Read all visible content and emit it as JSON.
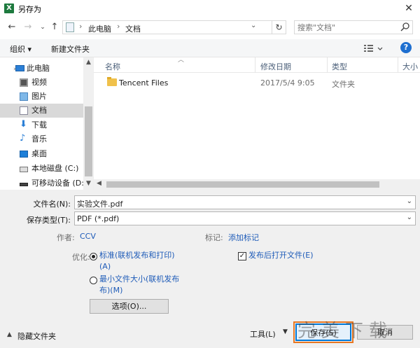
{
  "window": {
    "title": "另存为",
    "app_icon_letter": "X"
  },
  "address": {
    "path": [
      "此电脑",
      "文档"
    ],
    "search_placeholder": "搜索\"文档\""
  },
  "toolbar": {
    "organize": "组织 ▾",
    "new_folder": "新建文件夹",
    "help": "?"
  },
  "nav": {
    "items": [
      {
        "label": "此电脑",
        "icon": "computer-icon"
      },
      {
        "label": "视频",
        "icon": "video-icon"
      },
      {
        "label": "图片",
        "icon": "picture-icon"
      },
      {
        "label": "文档",
        "icon": "document-icon",
        "selected": true
      },
      {
        "label": "下载",
        "icon": "download-icon"
      },
      {
        "label": "音乐",
        "icon": "music-icon"
      },
      {
        "label": "桌面",
        "icon": "desktop-icon"
      },
      {
        "label": "本地磁盘 (C:)",
        "icon": "drive-icon"
      },
      {
        "label": "可移动设备 (D:)",
        "icon": "removable-drive-icon"
      }
    ]
  },
  "filelist": {
    "columns": [
      "名称",
      "修改日期",
      "类型",
      "大小"
    ],
    "rows": [
      {
        "name": "Tencent Files",
        "date": "2017/5/4 9:05",
        "type": "文件夹"
      }
    ]
  },
  "form": {
    "filename_label": "文件名(N):",
    "filename_value": "实验文件.pdf",
    "filetype_label": "保存类型(T):",
    "filetype_value": "PDF (*.pdf)",
    "author_label": "作者:",
    "author_value": "CCV",
    "tags_label": "标记:",
    "tags_value": "添加标记",
    "optimize_label": "优化:",
    "opt_standard_line1": "标准(联机发布和打印)",
    "opt_standard_line2": "(A)",
    "opt_min_line1": "最小文件大小(联机发布",
    "opt_min_line2": "布)(M)",
    "open_after": "发布后打开文件(E)",
    "options_button": "选项(O)...",
    "hide_folders": "隐藏文件夹",
    "tools": "工具(L)",
    "save": "保存(S)",
    "cancel": "取消"
  },
  "watermark": "完美下载"
}
